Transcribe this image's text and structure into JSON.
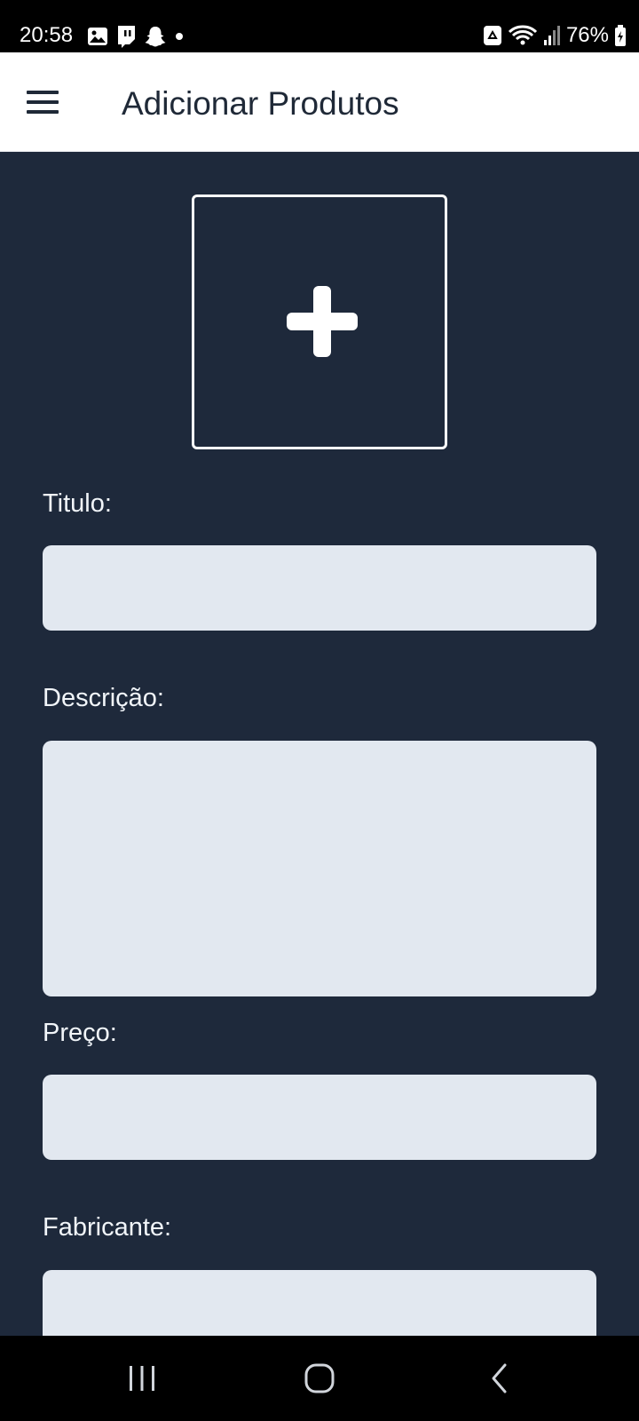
{
  "status_bar": {
    "time": "20:58",
    "battery": "76%",
    "left_icons": [
      "gallery-icon",
      "twitch-icon",
      "snapchat-icon",
      "dot-icon"
    ],
    "right_icons": [
      "recycle-icon",
      "wifi-icon",
      "signal-icon",
      "battery-icon"
    ]
  },
  "app_bar": {
    "title": "Adicionar Produtos",
    "menu_icon": "hamburger-menu-icon"
  },
  "form": {
    "image_picker_icon": "plus-icon",
    "titulo_label": "Titulo:",
    "titulo_value": "",
    "descricao_label": "Descrição:",
    "descricao_value": "",
    "preco_label": "Preço:",
    "preco_value": "",
    "fabricante_label": "Fabricante:",
    "fabricante_value": ""
  },
  "nav_bar": {
    "icons": [
      "recent-apps-icon",
      "home-icon",
      "back-icon"
    ]
  },
  "colors": {
    "background": "#1e293b",
    "input_fill": "#e2e8f0",
    "app_bar": "#ffffff",
    "text_light": "#f1f5f9",
    "text_dark": "#1f2937"
  }
}
